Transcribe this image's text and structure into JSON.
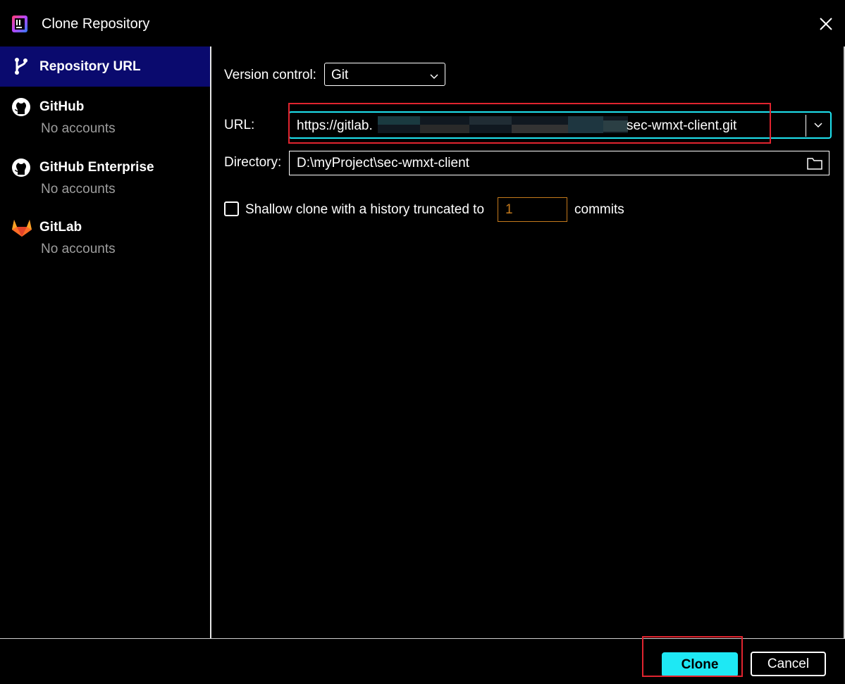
{
  "window": {
    "title": "Clone Repository",
    "app_icon": "intellij-idea-icon",
    "close_icon": "close-icon"
  },
  "sidebar": {
    "items": [
      {
        "label": "Repository URL",
        "sub": "",
        "icon": "git-branch-icon",
        "selected": true
      },
      {
        "label": "GitHub",
        "sub": "No accounts",
        "icon": "github-icon"
      },
      {
        "label": "GitHub Enterprise",
        "sub": "No accounts",
        "icon": "github-icon"
      },
      {
        "label": "GitLab",
        "sub": "No accounts",
        "icon": "gitlab-icon"
      }
    ]
  },
  "form": {
    "version_control_label": "Version control:",
    "version_control_value": "Git",
    "url_label": "URL:",
    "url_prefix": "https://gitlab.",
    "url_suffix": "sec-wmxt-client.git",
    "directory_label": "Directory:",
    "directory_value": "D:\\myProject\\sec-wmxt-client",
    "shallow_label": "Shallow clone with a history truncated to",
    "shallow_checked": false,
    "shallow_value": "1",
    "commits_label": "commits"
  },
  "buttons": {
    "clone": "Clone",
    "cancel": "Cancel"
  },
  "colors": {
    "accent": "#1ee8f4",
    "selected_bg": "#0a0a6e",
    "highlight": "#e0242f",
    "number_field": "#c47a1c"
  }
}
